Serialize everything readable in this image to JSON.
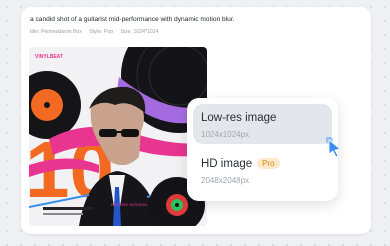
{
  "prompt_text": "a candid shot of a guitarist mid-performance with dynamic motion blur.",
  "meta": {
    "title": "title: Penteuklaron Box",
    "style": "Style: Pop",
    "size": "Size: 1024*1024"
  },
  "poster": {
    "brand_top": "VINYLBEAT",
    "small_caption": "RECORD SESSION"
  },
  "resolution_menu": {
    "options": [
      {
        "title": "Low-res image",
        "subtitle": "1024x1024px",
        "badge": ""
      },
      {
        "title": "HD image",
        "subtitle": "2048x2048px",
        "badge": "Pro"
      }
    ]
  },
  "colors": {
    "accent_blue": "#3a8ef0",
    "pro_bg": "#fde9c7",
    "pro_text": "#d58a1a",
    "poster_pink": "#e8358f",
    "poster_orange": "#f26a21",
    "poster_purple": "#a46be0"
  }
}
